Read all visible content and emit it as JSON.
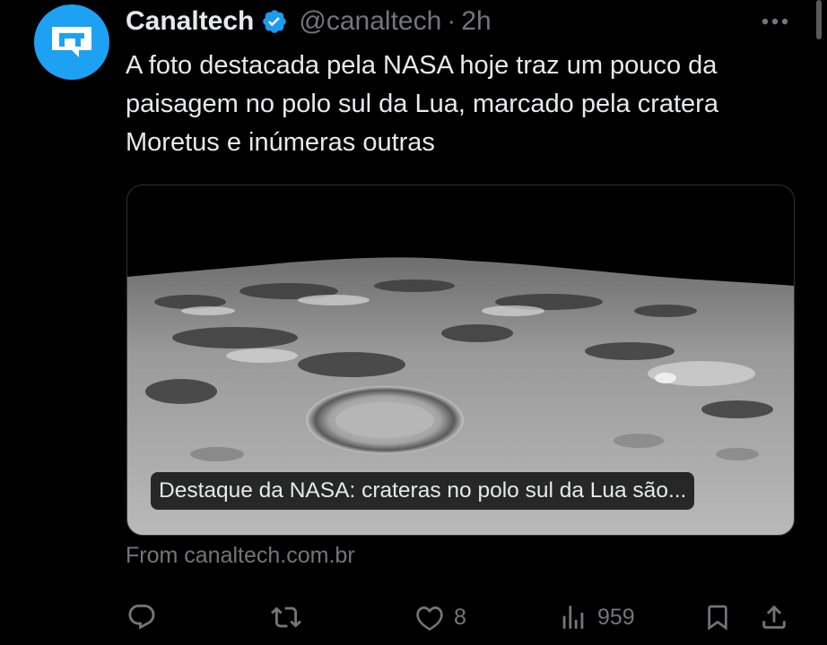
{
  "author": {
    "name": "Canaltech",
    "handle": "@canaltech",
    "separator": "·",
    "time": "2h"
  },
  "tweet": {
    "text": "A foto destacada pela NASA hoje traz um pouco da paisagem no polo sul da Lua, marcado pela cratera Moretus e inúmeras outras"
  },
  "card": {
    "caption": "Destaque da NASA: crateras no polo sul da Lua são...",
    "source": "From canaltech.com.br"
  },
  "actions": {
    "likes": "8",
    "views": "959"
  },
  "colors": {
    "background": "#000000",
    "avatar": "#1da1f2",
    "verified": "#1d9bf0",
    "muted": "#71767b",
    "text": "#e7e9ea"
  },
  "icons": [
    "verified-icon",
    "more-icon",
    "reply-icon",
    "retweet-icon",
    "like-icon",
    "views-icon",
    "bookmark-icon",
    "share-icon"
  ]
}
